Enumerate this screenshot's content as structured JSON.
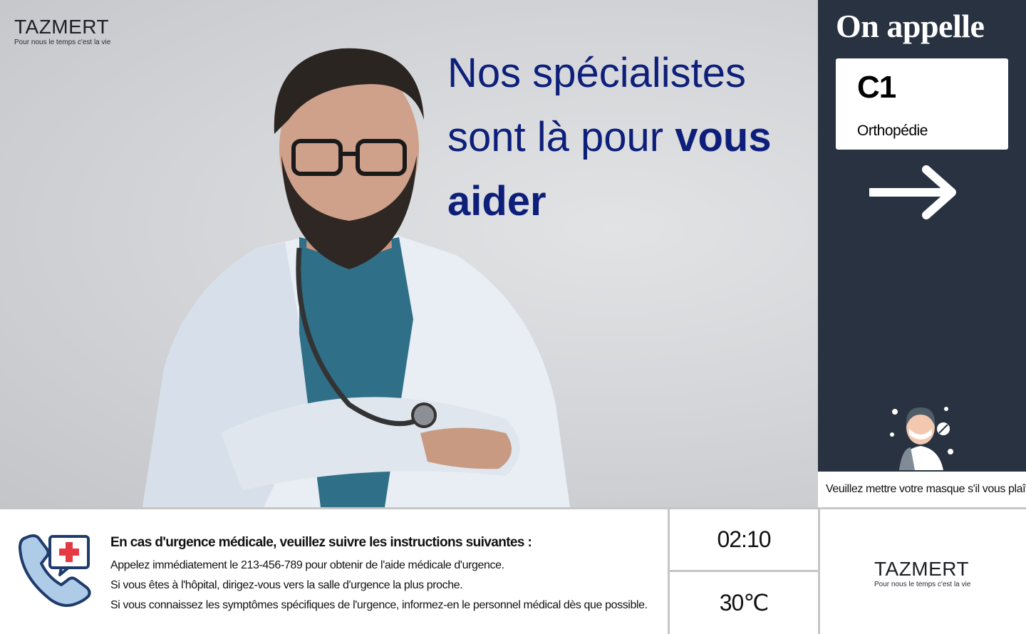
{
  "brand": {
    "name": "TAZMERT",
    "tagline": "Pour nous le temps c'est la vie"
  },
  "hero": {
    "headline_line1": "Nos spécialistes",
    "headline_line2_regular": "sont là pour ",
    "headline_line2_bold": "vous",
    "headline_line3_bold": "aider"
  },
  "call": {
    "title": "On appelle",
    "code": "C1",
    "department": "Orthopédie",
    "arrow_icon": "arrow-right-icon"
  },
  "ticker": {
    "message": "Veuillez mettre votre masque s'il vous plaît"
  },
  "emergency": {
    "title": "En cas d'urgence médicale, veuillez suivre les instructions suivantes :",
    "lines": [
      "Appelez immédiatement le 213-456-789 pour obtenir de l'aide médicale d'urgence.",
      "Si vous êtes à l'hôpital, dirigez-vous vers la salle d'urgence la plus proche.",
      "Si vous connaissez les symptômes spécifiques de l'urgence, informez-en le personnel médical dès que possible."
    ],
    "icon": "phone-medical-icon"
  },
  "status": {
    "time": "02:10",
    "temperature": "30℃"
  },
  "colors": {
    "headline": "#0d1f7a",
    "panel": "#283241",
    "divider": "#c6c6c6"
  }
}
